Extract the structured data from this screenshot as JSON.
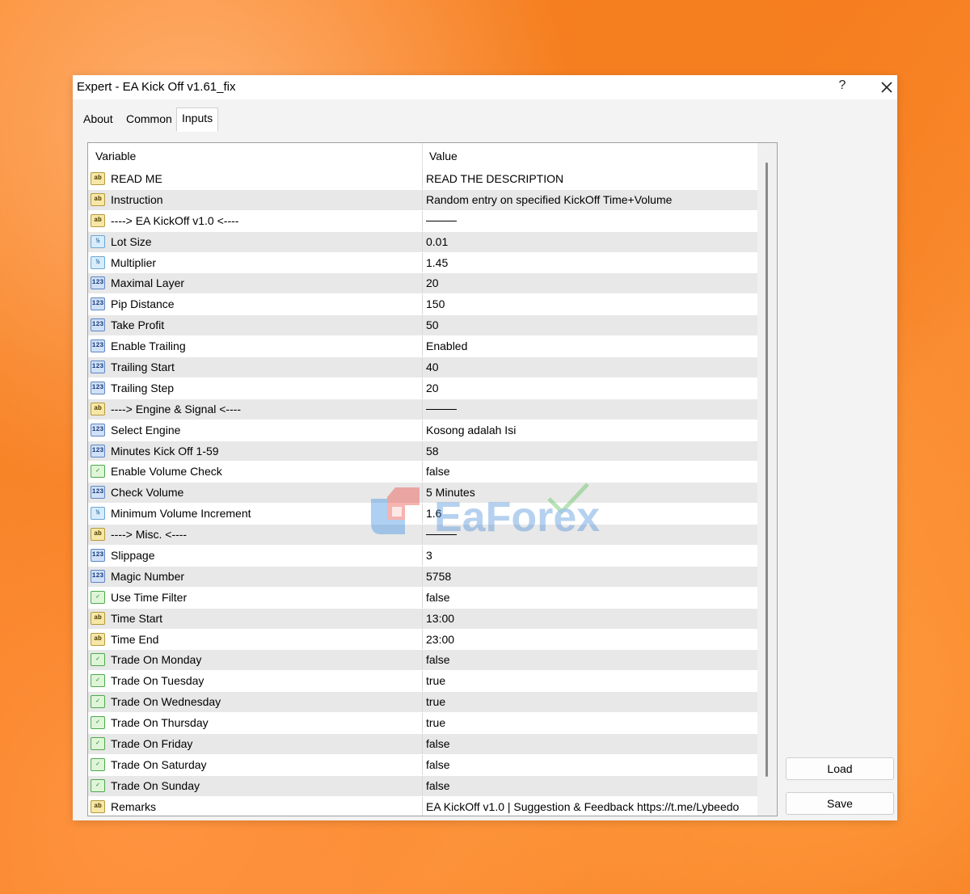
{
  "window": {
    "title": "Expert - EA Kick Off v1.61_fix",
    "help_label": "?"
  },
  "tabs": [
    {
      "label": "About"
    },
    {
      "label": "Common"
    },
    {
      "label": "Inputs"
    }
  ],
  "grid": {
    "header": {
      "variable": "Variable",
      "value": "Value"
    },
    "rows": [
      {
        "icon": "string-icon",
        "name": "READ ME",
        "value": "READ THE DESCRIPTION"
      },
      {
        "icon": "string-icon",
        "name": "Instruction",
        "value": "Random entry on specified KickOff Time+Volume"
      },
      {
        "icon": "string-icon",
        "name": "----> EA KickOff v1.0 <----",
        "value": ""
      },
      {
        "icon": "double-icon",
        "name": "Lot Size",
        "value": "0.01"
      },
      {
        "icon": "double-icon",
        "name": "Multiplier",
        "value": "1.45"
      },
      {
        "icon": "integer-icon",
        "name": "Maximal Layer",
        "value": "20"
      },
      {
        "icon": "integer-icon",
        "name": "Pip Distance",
        "value": "150"
      },
      {
        "icon": "integer-icon",
        "name": "Take Profit",
        "value": "50"
      },
      {
        "icon": "integer-icon",
        "name": "Enable Trailing",
        "value": "Enabled"
      },
      {
        "icon": "integer-icon",
        "name": "Trailing Start",
        "value": "40"
      },
      {
        "icon": "integer-icon",
        "name": "Trailing Step",
        "value": "20"
      },
      {
        "icon": "string-icon",
        "name": "----> Engine & Signal <----",
        "value": ""
      },
      {
        "icon": "integer-icon",
        "name": "Select Engine",
        "value": "Kosong adalah Isi"
      },
      {
        "icon": "integer-icon",
        "name": "Minutes Kick Off 1-59",
        "value": "58"
      },
      {
        "icon": "bool-icon",
        "name": "Enable Volume Check",
        "value": "false"
      },
      {
        "icon": "integer-icon",
        "name": "Check Volume",
        "value": "5 Minutes"
      },
      {
        "icon": "double-icon",
        "name": "Minimum Volume Increment",
        "value": "1.6"
      },
      {
        "icon": "string-icon",
        "name": "----> Misc. <----",
        "value": ""
      },
      {
        "icon": "integer-icon",
        "name": "Slippage",
        "value": "3"
      },
      {
        "icon": "integer-icon",
        "name": "Magic Number",
        "value": "5758"
      },
      {
        "icon": "bool-icon",
        "name": "Use Time Filter",
        "value": "false"
      },
      {
        "icon": "string-icon",
        "name": "Time Start",
        "value": "13:00"
      },
      {
        "icon": "string-icon",
        "name": "Time End",
        "value": "23:00"
      },
      {
        "icon": "bool-icon",
        "name": "Trade On Monday",
        "value": "false"
      },
      {
        "icon": "bool-icon",
        "name": "Trade On Tuesday",
        "value": "true"
      },
      {
        "icon": "bool-icon",
        "name": "Trade On Wednesday",
        "value": "true"
      },
      {
        "icon": "bool-icon",
        "name": "Trade On Thursday",
        "value": "true"
      },
      {
        "icon": "bool-icon",
        "name": "Trade On Friday",
        "value": "false"
      },
      {
        "icon": "bool-icon",
        "name": "Trade On Saturday",
        "value": "false"
      },
      {
        "icon": "bool-icon",
        "name": "Trade On Sunday",
        "value": "false"
      },
      {
        "icon": "string-icon",
        "name": "Remarks",
        "value": "EA KickOff v1.0 | Suggestion & Feedback https://t.me/Lybeedo"
      }
    ]
  },
  "buttons": {
    "load_label": "Load",
    "save_label": "Save"
  },
  "watermark": {
    "text": "EaForex"
  },
  "colors": {
    "background_accent": "#f57a1c",
    "row_alt": "#e8e8e8"
  }
}
